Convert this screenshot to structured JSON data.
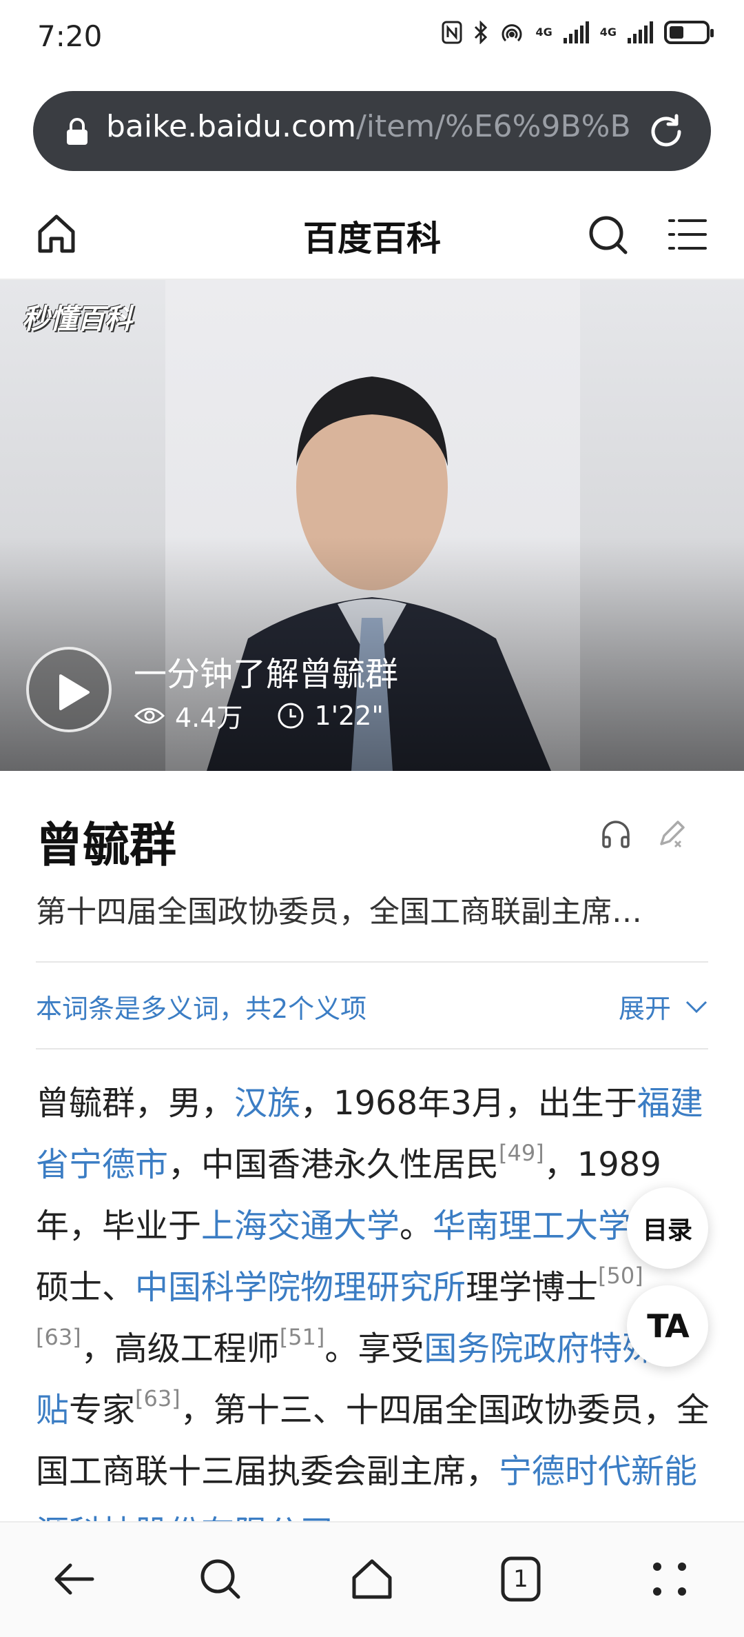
{
  "status_bar": {
    "time": "7:20",
    "network_1": "4G",
    "network_2": "4G",
    "battery_level": 0.4
  },
  "url_bar": {
    "host": "baike.baidu.com",
    "path": "/item/%E6%9B%B"
  },
  "header": {
    "title": "百度百科"
  },
  "hero": {
    "logo_text": "秒懂百科",
    "video_title": "一分钟了解曾毓群",
    "views": "4.4万",
    "duration": "1'22\""
  },
  "entry": {
    "title": "曾毓群",
    "summary": "第十四届全国政协委员，全国工商联副主席…",
    "polysemy_text": "本词条是多义词，共2个义项",
    "expand_label": "展开"
  },
  "body": {
    "t1": "曾毓群，男，",
    "l1": "汉族",
    "t2": "，1968年3月，出生于",
    "l2": "福建省宁德市",
    "t3": "，中国香港永久性居民",
    "r1": "[49]",
    "t4": "，1989年，毕业于",
    "l3": "上海交通大学",
    "t5": "。",
    "l4": "华南理工大学",
    "t6": "工学硕士、",
    "l5": "中国科学院物理研究所",
    "t7": "理学博士",
    "r2": "[50][63]",
    "t8": "，高级工程师",
    "r3": "[51]",
    "t9": "。享受",
    "l6": "国务院政府特殊津贴",
    "t10": "专家",
    "r4": "[63]",
    "t11": "，第十三、十四届全国政协委员，全国工商联十三届执委会副主席，",
    "l7": "宁德时代新能源科技股份有限公司"
  },
  "floating": {
    "toc_label": "目录",
    "ta_label": "TA"
  },
  "bottom_nav": {
    "tab_count": "1"
  },
  "colors": {
    "link": "#3b7dc4",
    "url_bar_bg": "#3a3d42"
  }
}
